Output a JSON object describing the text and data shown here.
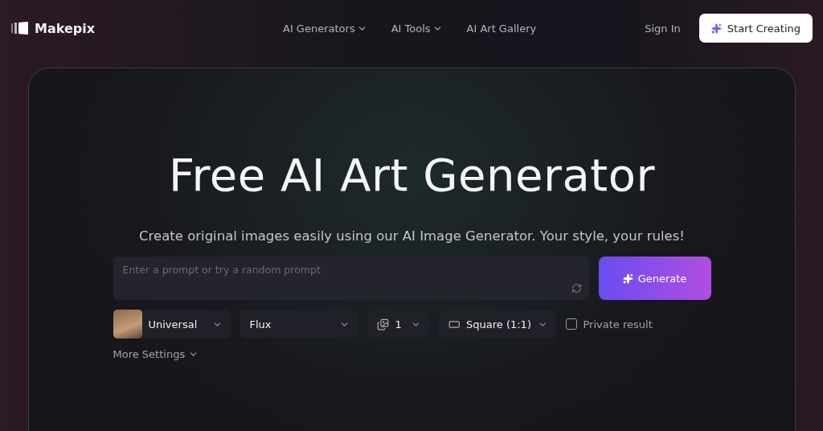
{
  "brand": {
    "name": "Makepix"
  },
  "nav": [
    {
      "label": "AI Generators",
      "has_menu": true
    },
    {
      "label": "AI Tools",
      "has_menu": true
    },
    {
      "label": "AI Art Gallery",
      "has_menu": false
    }
  ],
  "sign_in": "Sign In",
  "start_button": "Start Creating",
  "hero": {
    "title": "Free AI Art Generator",
    "subtitle": "Create original images easily using our AI Image Generator. Your style, your rules!"
  },
  "prompt": {
    "placeholder": "Enter a prompt or try a random prompt"
  },
  "generate_button": "Generate",
  "options": [
    {
      "kind": "style",
      "value": "Universal"
    },
    {
      "kind": "model",
      "value": "Flux"
    },
    {
      "kind": "count",
      "value": "1"
    },
    {
      "kind": "ratio",
      "value": "Square (1:1)"
    }
  ],
  "private_result": {
    "label": "Private result",
    "checked": false
  },
  "more_settings": "More Settings"
}
